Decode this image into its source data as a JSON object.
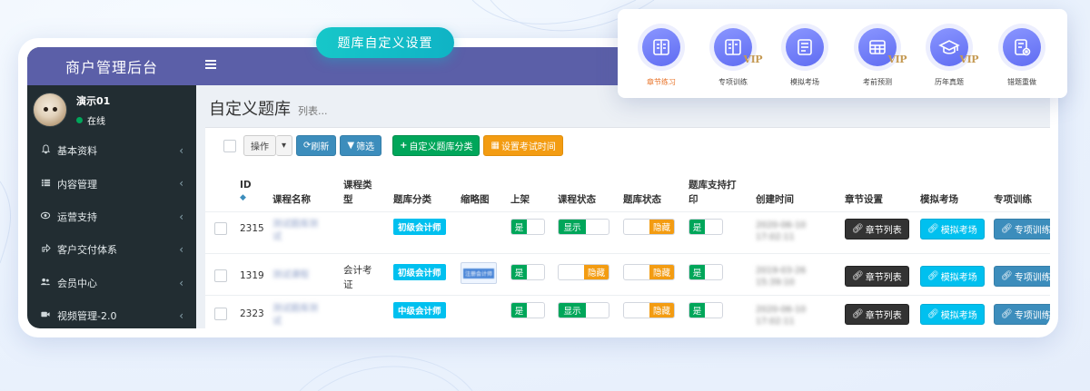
{
  "badge": {
    "label": "题库自定义设置"
  },
  "feature_icons": [
    {
      "label": "章节练习",
      "icon": "book-icon",
      "vip": false,
      "active": true
    },
    {
      "label": "专项训练",
      "icon": "book-vip-icon",
      "vip": true,
      "active": false
    },
    {
      "label": "模拟考场",
      "icon": "exam-sheet-icon",
      "vip": false,
      "active": false
    },
    {
      "label": "考前预测",
      "icon": "grid-vip-icon",
      "vip": true,
      "active": false
    },
    {
      "label": "历年真题",
      "icon": "graduation-cap-icon",
      "vip": true,
      "active": false
    },
    {
      "label": "错题重做",
      "icon": "wrong-answer-icon",
      "vip": false,
      "active": false
    }
  ],
  "vip_text": "VIP",
  "brand": {
    "title": "商户管理后台"
  },
  "user": {
    "name": "演示01",
    "status": "在线"
  },
  "sidebar": {
    "items": [
      {
        "label": "基本资料",
        "icon": "bell-icon"
      },
      {
        "label": "内容管理",
        "icon": "list-icon"
      },
      {
        "label": "运营支持",
        "icon": "eye-icon"
      },
      {
        "label": "客户交付体系",
        "icon": "share-icon"
      },
      {
        "label": "会员中心",
        "icon": "users-icon"
      },
      {
        "label": "视频管理-2.0",
        "icon": "video-icon"
      }
    ]
  },
  "page": {
    "title": "自定义题库",
    "subtitle": "列表..."
  },
  "toolbar": {
    "operate": "操作",
    "refresh": "刷新",
    "filter": "筛选",
    "add_category": "自定义题库分类",
    "set_exam_time": "设置考试时间"
  },
  "table": {
    "headers": {
      "id": "ID",
      "course_name": "课程名称",
      "course_type_1": "课程类",
      "course_type_2": "型",
      "category": "题库分类",
      "thumbnail": "缩略图",
      "listed": "上架",
      "course_status": "课程状态",
      "bank_status": "题库状态",
      "print_1": "题库支持打",
      "print_2": "印",
      "created": "创建时间",
      "chapter_settings": "章节设置",
      "mock_exam": "模拟考场",
      "special_training": "专项训练"
    },
    "rows": [
      {
        "id": "2315",
        "name_1": "测试题库测",
        "name_2": "试",
        "type_1": "",
        "type_2": "",
        "category": "初级会计师",
        "thumb": "",
        "listed": "是",
        "course_status_on": "显示",
        "course_status_off": "",
        "bank_status_on": "",
        "bank_status_off": "隐藏",
        "print": "是",
        "created_date": "2020-06-10",
        "created_time": "17:02:11",
        "btn_chapter": "章节列表",
        "btn_mock": "模拟考场",
        "btn_special": "专项训练"
      },
      {
        "id": "1319",
        "name_1": "测试课程",
        "name_2": "",
        "type_1": "会计考",
        "type_2": "证",
        "category": "初级会计师",
        "thumb": "注册会计师",
        "listed": "是",
        "course_status_on": "",
        "course_status_off": "隐藏",
        "bank_status_on": "",
        "bank_status_off": "隐藏",
        "print": "是",
        "created_date": "2019-03-26",
        "created_time": "15:39:10",
        "btn_chapter": "章节列表",
        "btn_mock": "模拟考场",
        "btn_special": "专项训练"
      },
      {
        "id": "2323",
        "name_1": "测试题库测",
        "name_2": "试",
        "type_1": "",
        "type_2": "",
        "category": "中级会计师",
        "thumb": "",
        "listed": "是",
        "course_status_on": "显示",
        "course_status_off": "",
        "bank_status_on": "",
        "bank_status_off": "隐藏",
        "print": "是",
        "created_date": "2020-06-10",
        "created_time": "17:02:11",
        "btn_chapter": "章节列表",
        "btn_mock": "模拟考场",
        "btn_special": "专项训练"
      }
    ]
  },
  "colors": {
    "header_purple": "#5b5fa8",
    "sidebar_dark": "#222d32",
    "badge_teal": "#17c7c9",
    "tag_cyan": "#00c0ef",
    "toggle_green": "#00a65a",
    "toggle_orange": "#f39c12",
    "icon_purple": "#6a76f5",
    "vip_gold": "#c59a54"
  }
}
